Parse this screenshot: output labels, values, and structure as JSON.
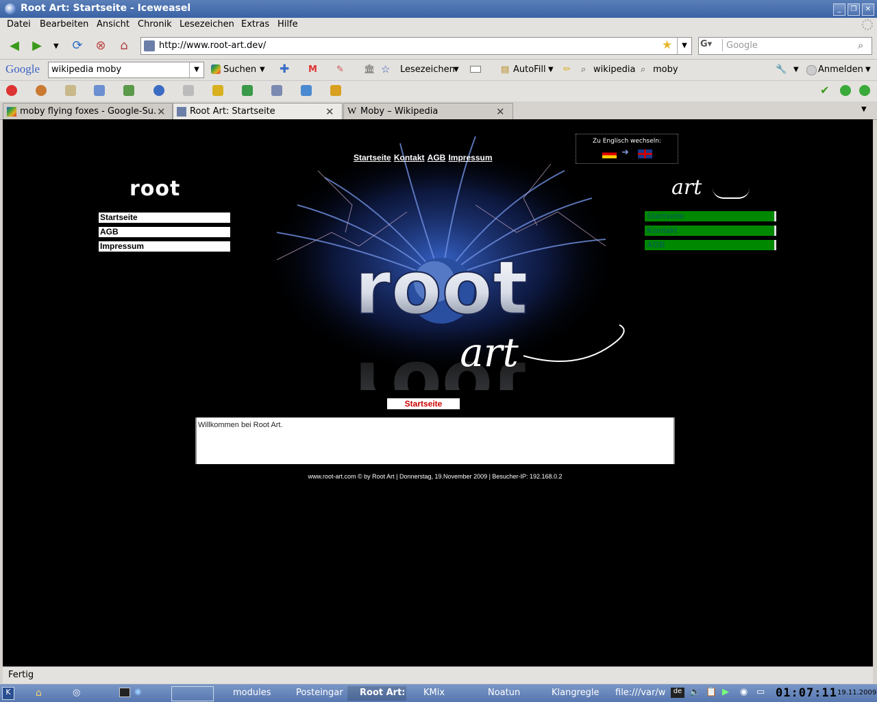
{
  "window": {
    "title": "Root Art: Startseite - Iceweasel"
  },
  "menu": [
    "Datei",
    "Bearbeiten",
    "Ansicht",
    "Chronik",
    "Lesezeichen",
    "Extras",
    "Hilfe"
  ],
  "nav": {
    "url": "http://www.root-art.dev/",
    "search_placeholder": "Google"
  },
  "google_toolbar": {
    "logo": "Google",
    "query": "wikipedia moby",
    "search_label": "Suchen",
    "bookmarks_label": "Lesezeichen",
    "autofill_label": "AutoFill",
    "term1": "wikipedia",
    "term2": "moby",
    "signin_label": "Anmelden"
  },
  "tabs": [
    {
      "label": "moby flying foxes - Google-Su..."
    },
    {
      "label": "Root Art: Startseite"
    },
    {
      "label": "Moby – Wikipedia"
    }
  ],
  "page": {
    "top_links": [
      "Startseite",
      "Kontakt",
      "AGB",
      "Impressum"
    ],
    "lang_label": "Zu Englisch wechseln:",
    "left_brand": "root",
    "right_brand": "art",
    "left_menu": [
      "Startseite",
      "AGB",
      "Impressum"
    ],
    "right_menu": [
      "Startseite",
      "Kontakt",
      "AGB"
    ],
    "hero_word": "root",
    "hero_art": "art",
    "section_title": "Startseite",
    "welcome": "Willkommen bei Root Art.",
    "footer": "www.root-art.com © by  Root Art | Donnerstag, 19.November 2009 | Besucher-IP: 192.168.0.2"
  },
  "status": "Fertig",
  "taskbar": {
    "items": [
      "modules",
      "Posteingar",
      "Root Art:",
      "KMix",
      "Noatun",
      "Klangregle",
      "file:///var/w"
    ],
    "lang": "de",
    "clock": "01:07:11",
    "date": "19.11.2009"
  },
  "colors": {
    "titlebar": "#3b63a6",
    "page_bg": "#000000",
    "right_menu": "#008800",
    "section_title": "#cc0000"
  }
}
